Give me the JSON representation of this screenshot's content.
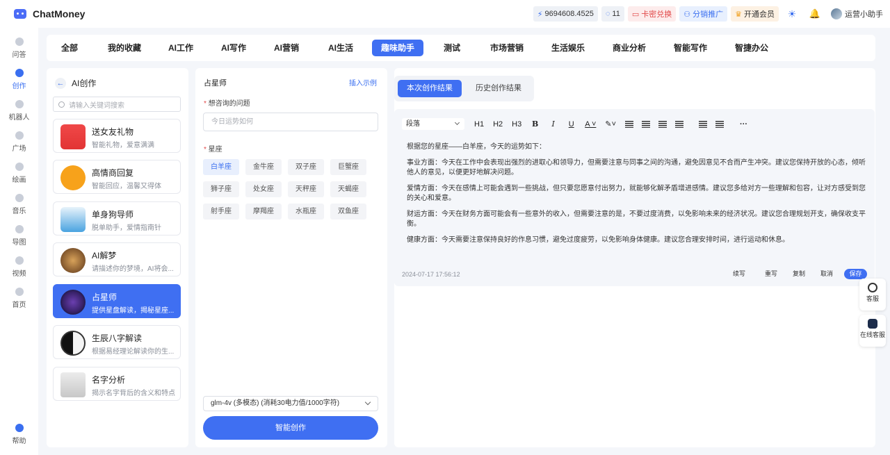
{
  "app": {
    "name": "ChatMoney"
  },
  "header": {
    "balance": "9694608.4525",
    "count": "11",
    "card_redeem": "卡密兑换",
    "distribution": "分销推广",
    "membership": "开通会员",
    "username": "运营小助手"
  },
  "rail": [
    {
      "label": "问答"
    },
    {
      "label": "创作"
    },
    {
      "label": "机器人"
    },
    {
      "label": "广场"
    },
    {
      "label": "绘画"
    },
    {
      "label": "音乐"
    },
    {
      "label": "导图"
    },
    {
      "label": "视频"
    },
    {
      "label": "首页"
    },
    {
      "label": "帮助"
    }
  ],
  "tabs": [
    "全部",
    "我的收藏",
    "AI工作",
    "AI写作",
    "AI营销",
    "AI生活",
    "趣味助手",
    "测试",
    "市场营销",
    "生活娱乐",
    "商业分析",
    "智能写作",
    "智捷办公"
  ],
  "sidebar": {
    "title": "AI创作",
    "search_placeholder": "请输入关键词搜索",
    "items": [
      {
        "title": "送女友礼物",
        "desc": "智能礼物，爱意满满"
      },
      {
        "title": "高情商回复",
        "desc": "智能回应，温馨又得体"
      },
      {
        "title": "单身狗导师",
        "desc": "脱单助手，爱情指南针"
      },
      {
        "title": "AI解梦",
        "desc": "请描述你的梦境，AI将会..."
      },
      {
        "title": "占星师",
        "desc": "提供星盘解读，揭秘星座..."
      },
      {
        "title": "生辰八字解读",
        "desc": "根据易经理论解读你的生..."
      },
      {
        "title": "名字分析",
        "desc": "揭示名字背后的含义和特点"
      }
    ]
  },
  "form": {
    "title": "占星师",
    "insert_example": "插入示例",
    "question_label": "想咨询的问题",
    "question_placeholder": "今日运势如何",
    "sign_label": "星座",
    "signs": [
      "白羊座",
      "金牛座",
      "双子座",
      "巨蟹座",
      "狮子座",
      "处女座",
      "天秤座",
      "天蝎座",
      "射手座",
      "摩羯座",
      "水瓶座",
      "双鱼座"
    ],
    "selected_sign": "白羊座",
    "model": "glm-4v (多模态) (消耗30电力值/1000字符)",
    "generate": "智能创作"
  },
  "result": {
    "tab_current": "本次创作结果",
    "tab_history": "历史创作结果",
    "paragraph_select": "段落",
    "paragraphs": [
      "根据您的星座——白羊座，今天的运势如下：",
      "事业方面：今天在工作中会表现出强烈的进取心和领导力，但需要注意与同事之间的沟通，避免因意见不合而产生冲突。建议您保持开放的心态，倾听他人的意见，以便更好地解决问题。",
      "爱情方面：今天在感情上可能会遇到一些挑战，但只要您愿意付出努力，就能够化解矛盾增进感情。建议您多给对方一些理解和包容，让对方感受到您的关心和爱意。",
      "财运方面：今天在财务方面可能会有一些意外的收入，但需要注意的是，不要过度消费，以免影响未来的经济状况。建议您合理规划开支，确保收支平衡。",
      "健康方面：今天需要注意保持良好的作息习惯，避免过度疲劳，以免影响身体健康。建议您合理安排时间，进行运动和休息。"
    ],
    "timestamp": "2024-07-17 17:56:12",
    "actions": {
      "continue": "续写",
      "rewrite": "重写",
      "copy": "复制",
      "cancel": "取消",
      "save": "保存"
    }
  },
  "floating": {
    "service": "客服",
    "online_service": "在线客服"
  },
  "colors": {
    "accent": "#3f6ff2",
    "danger": "#e14848"
  }
}
